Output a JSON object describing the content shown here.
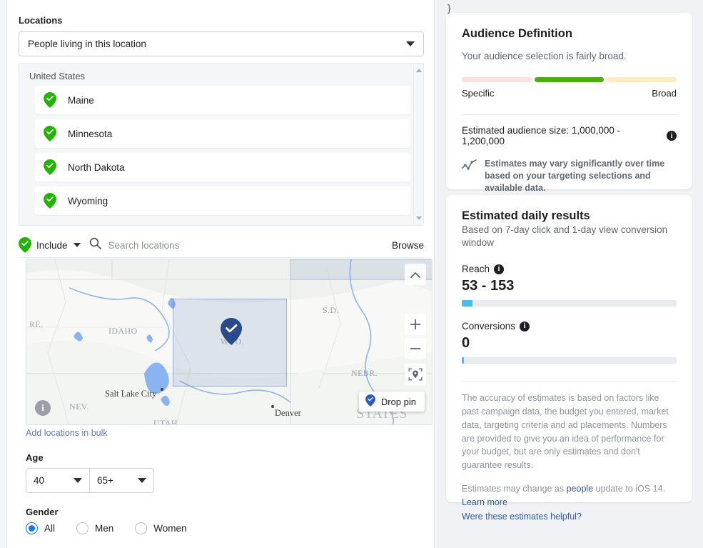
{
  "left": {
    "locations_label": "Locations",
    "location_type": {
      "value": "People living in this location",
      "icon": "chevron-down-icon"
    },
    "country_header": "United States",
    "selected_locations": [
      {
        "name": "Maine",
        "icon": "green-pin-check-icon"
      },
      {
        "name": "Minnesota",
        "icon": "green-pin-check-icon"
      },
      {
        "name": "North Dakota",
        "icon": "green-pin-check-icon"
      },
      {
        "name": "Wyoming",
        "icon": "green-pin-check-icon"
      }
    ],
    "include_row": {
      "include_label": "Include",
      "search_placeholder": "Search locations",
      "search_value": "",
      "browse_label": "Browse"
    },
    "map": {
      "state_labels": [
        "RE.",
        "IDAHO",
        "S.D.",
        "WYO.",
        "NEBR.",
        "NEV.",
        "UTAH",
        "STATES"
      ],
      "city_labels": [
        "Salt Lake City",
        "Denver"
      ],
      "drop_pin_label": "Drop pin",
      "info_badge": "i",
      "controls": [
        "chevron-up-icon",
        "zoom-in-icon",
        "zoom-out-icon",
        "locate-icon"
      ]
    },
    "bulk_link": "Add locations in bulk",
    "age_label": "Age",
    "age_min": "40",
    "age_max": "65+",
    "gender_label": "Gender",
    "gender_options": [
      "All",
      "Men",
      "Women"
    ],
    "gender_selected": "All"
  },
  "right": {
    "stray_char": "}",
    "audience": {
      "title": "Audience Definition",
      "subtitle": "Your audience selection is fairly broad.",
      "gauge_left_label": "Specific",
      "gauge_right_label": "Broad",
      "gauge_colors": [
        "#fbe2dd",
        "#4caf0f",
        "#fbecc3"
      ],
      "gauge_active_index": 1,
      "size_text": "Estimated audience size: 1,000,000 - 1,200,000",
      "note": "Estimates may vary significantly over time based on your targeting selections and available data."
    },
    "results": {
      "title": "Estimated daily results",
      "subtitle": "Based on 7-day click and 1-day view conversion window",
      "reach_label": "Reach",
      "reach_value": "53 - 153",
      "reach_fill_pct": 5,
      "conversions_label": "Conversions",
      "conversions_value": "0",
      "conversions_fill_pct": 1,
      "bar_color": "#4bbdeb",
      "disclaimer": "The accuracy of estimates is based on factors like past campaign data, the budget you entered, market data, targeting criteria and ad placements. Numbers are provided to give you an idea of performance for your budget, but are only estimates and don't guarantee results.",
      "ios_prefix": "Estimates may change as ",
      "ios_link": "people",
      "ios_mid": " update to iOS 14. ",
      "learn_more": "Learn more",
      "helpful_link": "Were these estimates helpful?"
    }
  }
}
